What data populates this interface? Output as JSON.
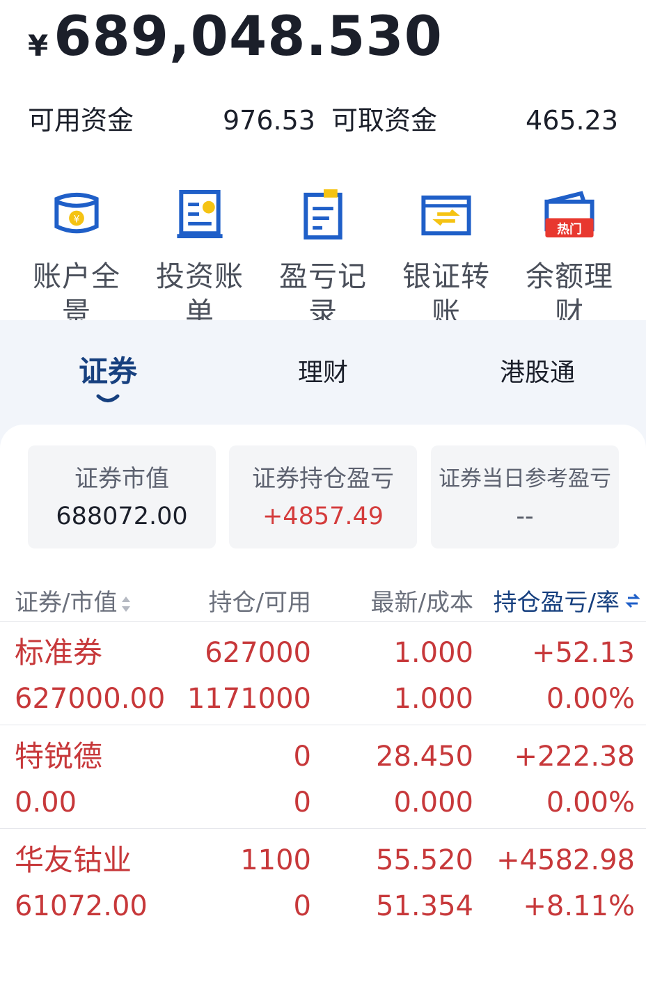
{
  "header": {
    "currency_symbol": "¥",
    "total_assets": "689,048.530"
  },
  "funds": {
    "available_label": "可用资金",
    "available_value": "976.53",
    "withdrawable_label": "可取资金",
    "withdrawable_value": "465.23"
  },
  "shortcuts": [
    {
      "label": "账户全景",
      "icon": "account-overview-icon"
    },
    {
      "label": "投资账单",
      "icon": "investment-bill-icon"
    },
    {
      "label": "盈亏记录",
      "icon": "profit-loss-record-icon"
    },
    {
      "label": "银证转账",
      "icon": "bank-transfer-icon"
    },
    {
      "label": "余额理财",
      "icon": "balance-wealth-icon",
      "badge": "热门"
    }
  ],
  "tabs": [
    {
      "label": "证券",
      "active": true
    },
    {
      "label": "理财",
      "active": false
    },
    {
      "label": "港股通",
      "active": false
    }
  ],
  "stats": [
    {
      "title": "证券市值",
      "value": "688072.00"
    },
    {
      "title": "证券持仓盈亏",
      "value": "+4857.49"
    },
    {
      "title": "证券当日参考盈亏",
      "value": "--"
    }
  ],
  "table": {
    "headers": [
      "证券/市值",
      "持仓/可用",
      "最新/成本",
      "持仓盈亏/率"
    ],
    "rows": [
      {
        "name": "标准券",
        "market_value": "627000.00",
        "position": "627000",
        "available": "1171000",
        "latest": "1.000",
        "cost": "1.000",
        "pnl": "+52.13",
        "pnl_rate": "0.00%"
      },
      {
        "name": "特锐德",
        "market_value": "0.00",
        "position": "0",
        "available": "0",
        "latest": "28.450",
        "cost": "0.000",
        "pnl": "+222.38",
        "pnl_rate": "0.00%"
      },
      {
        "name": "华友钴业",
        "market_value": "61072.00",
        "position": "1100",
        "available": "0",
        "latest": "55.520",
        "cost": "51.354",
        "pnl": "+4582.98",
        "pnl_rate": "+8.11%"
      }
    ]
  },
  "colors": {
    "accent_blue": "#17407f",
    "icon_blue": "#1f5fc8",
    "icon_yellow": "#f5c313",
    "profit_red": "#c7383a",
    "hot_badge": "#e8382f"
  }
}
